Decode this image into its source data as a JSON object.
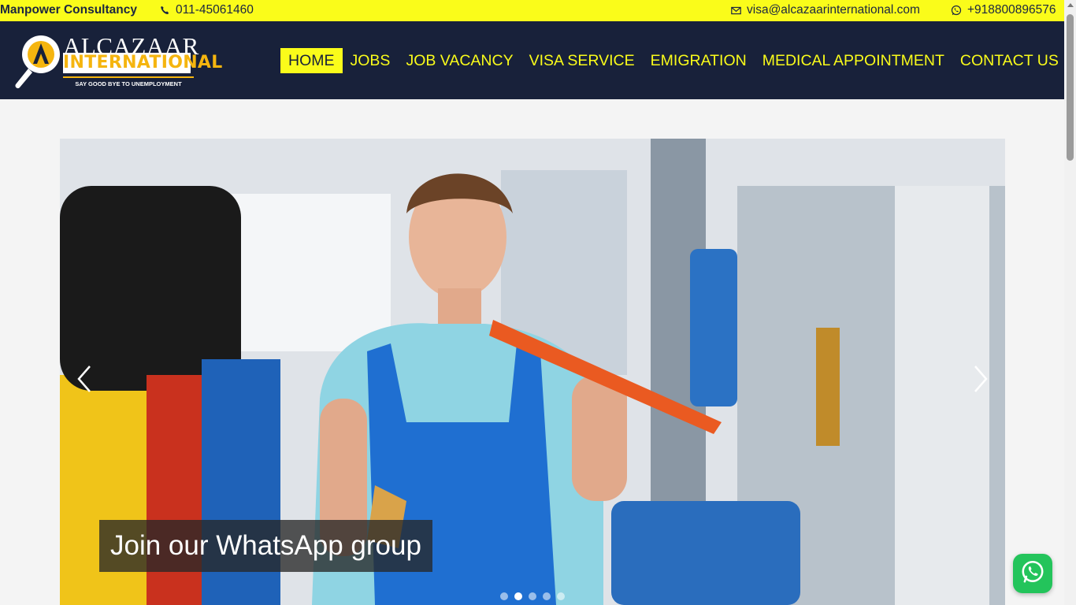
{
  "topbar": {
    "brand": "Manpower Consultancy",
    "phone": "011-45061460",
    "email": "visa@alcazaarinternational.com",
    "whatsapp": "+918800896576"
  },
  "logo": {
    "name_line1": "ALCAZAAR",
    "name_line2": "INTERNATIONAL",
    "tagline": "SAY GOOD BYE TO UNEMPLOYMENT"
  },
  "nav": {
    "items": [
      {
        "label": "HOME",
        "active": true
      },
      {
        "label": "JOBS",
        "active": false
      },
      {
        "label": "JOB VACANCY",
        "active": false
      },
      {
        "label": "VISA SERVICE",
        "active": false
      },
      {
        "label": "EMIGRATION",
        "active": false
      },
      {
        "label": "MEDICAL APPOINTMENT",
        "active": false
      },
      {
        "label": "CONTACT US",
        "active": false
      }
    ]
  },
  "slider": {
    "caption": "Join our WhatsApp group",
    "slide_count": 5,
    "active_slide": 2
  },
  "colors": {
    "accent_yellow": "#fafc1a",
    "header_navy": "#18213a",
    "whatsapp_green": "#23c45b",
    "logo_gold": "#f5b50f"
  },
  "icons": {
    "phone": "phone-icon",
    "email": "envelope-icon",
    "whatsapp": "whatsapp-icon",
    "prev": "chevron-left-icon",
    "next": "chevron-right-icon"
  }
}
